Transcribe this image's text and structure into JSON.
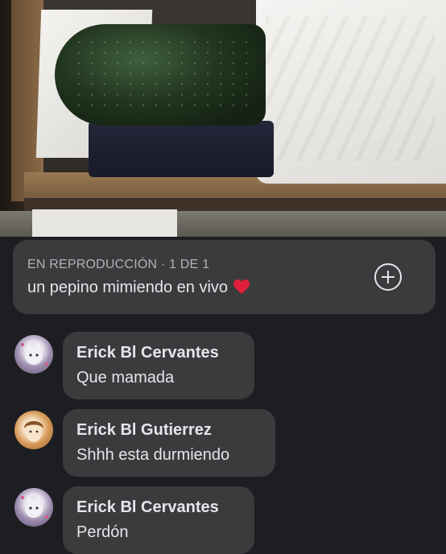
{
  "now_playing": {
    "status": "EN REPRODUCCIÓN · 1 DE 1",
    "title": "un pepino mimiendo en vivo",
    "heart_icon": "red-heart-emoji",
    "add_icon": "plus-circle-icon"
  },
  "comments": [
    {
      "author": "Erick Bl Cervantes",
      "text": "Que mamada",
      "avatar": "cat-avatar"
    },
    {
      "author": "Erick Bl Gutierrez",
      "text": "Shhh esta durmiendo",
      "avatar": "girl-avatar"
    },
    {
      "author": "Erick Bl Cervantes",
      "text": "Perdón",
      "avatar": "cat-avatar"
    }
  ],
  "colors": {
    "background": "#1c1e21",
    "card": "#3a3b3c",
    "text_primary": "#e4e6eb",
    "text_secondary": "#b0b3b8",
    "heart": "#e0203a"
  }
}
